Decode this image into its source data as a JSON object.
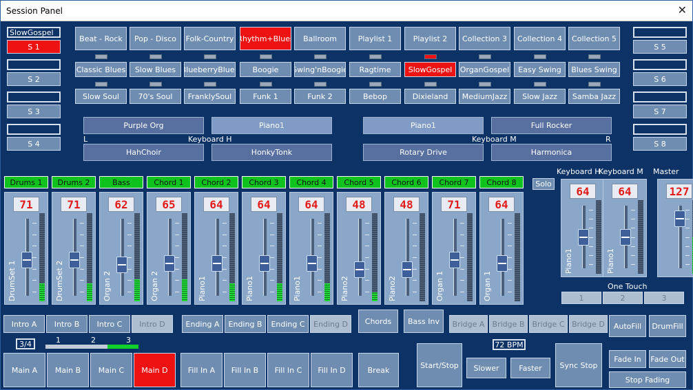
{
  "window": {
    "title": "Session Panel",
    "close_label": "✕"
  },
  "left_slots": [
    {
      "name": "SlowGospel",
      "button": "S 1",
      "active": true
    },
    {
      "name": "",
      "button": "S 2",
      "active": false
    },
    {
      "name": "",
      "button": "S 3",
      "active": false
    },
    {
      "name": "",
      "button": "S 4",
      "active": false
    }
  ],
  "right_slots": [
    {
      "name": "",
      "button": "S 5"
    },
    {
      "name": "",
      "button": "S 6"
    },
    {
      "name": "",
      "button": "S 7"
    },
    {
      "name": "",
      "button": "S 8"
    }
  ],
  "style_rows": [
    {
      "buttons": [
        "Beat - Rock",
        "Pop - Disco",
        "Folk-Country",
        "Rhythm+Blues",
        "Ballroom",
        "Playlist 1",
        "Playlist 2",
        "Collection 3",
        "Collection 4",
        "Collection 5"
      ],
      "active": 3
    },
    {
      "buttons": [
        "Classic Blues",
        "Slow Blues",
        "BlueberryBlues",
        "Boogie",
        "Swing'nBoogie",
        "Ragtime",
        "SlowGospel",
        "OrganGospel",
        "Easy Swing",
        "Blues Swing"
      ],
      "active": 6,
      "led_active": 6
    },
    {
      "buttons": [
        "Slow Soul",
        "70's Soul",
        "FranklySoul",
        "Funk 1",
        "Funk 2",
        "Bebop",
        "Dixieland",
        "MediumJazz",
        "Slow Jazz",
        "Samba Jazz"
      ],
      "active": -1
    }
  ],
  "keyboards": {
    "h_label": "Keyboard H",
    "m_label": "Keyboard M",
    "l_label": "L",
    "r_label": "R",
    "h_top": [
      "Purple Org",
      "Piano1"
    ],
    "h_bottom": [
      "HahChoir",
      "HonkyTonk"
    ],
    "m_top": [
      "Piano1",
      "Full Rocker"
    ],
    "m_bottom": [
      "Rotary Drive",
      "Harmonica"
    ]
  },
  "channels": [
    {
      "label": "Drums 1",
      "volume": "71",
      "instrument": "DrumSet 1",
      "level": 0.45,
      "meter": 0.2
    },
    {
      "label": "Drums 2",
      "volume": "71",
      "instrument": "DrumSet 2",
      "level": 0.45,
      "meter": 0.2
    },
    {
      "label": "Bass",
      "volume": "62",
      "instrument": "Organ 2",
      "level": 0.38,
      "meter": 0.25
    },
    {
      "label": "Chord 1",
      "volume": "65",
      "instrument": "Organ 2",
      "level": 0.4,
      "meter": 0.25
    },
    {
      "label": "Chord 2",
      "volume": "64",
      "instrument": "Piano1",
      "level": 0.4,
      "meter": 0.2
    },
    {
      "label": "Chord 3",
      "volume": "64",
      "instrument": "Piano1",
      "level": 0.4,
      "meter": 0.2
    },
    {
      "label": "Chord 4",
      "volume": "64",
      "instrument": "Piano1",
      "level": 0.4,
      "meter": 0.2
    },
    {
      "label": "Chord 5",
      "volume": "48",
      "instrument": "Piano2",
      "level": 0.3,
      "meter": 0.1
    },
    {
      "label": "Chord 6",
      "volume": "48",
      "instrument": "Piano2",
      "level": 0.3,
      "meter": 0
    },
    {
      "label": "Chord 7",
      "volume": "71",
      "instrument": "Organ 1",
      "level": 0.45,
      "meter": 0
    },
    {
      "label": "Chord 8",
      "volume": "64",
      "instrument": "Organ 1",
      "level": 0.4,
      "meter": 0
    }
  ],
  "solo_label": "Solo",
  "right_channels": [
    {
      "label": "Keyboard H",
      "volume": "64",
      "instrument": "Piano1",
      "level": 0.5
    },
    {
      "label": "Keyboard M",
      "volume": "64",
      "instrument": "Piano1",
      "level": 0.5
    },
    {
      "label": "Master",
      "volume": "127",
      "instrument": "",
      "level": 0.9
    }
  ],
  "one_touch": {
    "label": "One Touch",
    "buttons": [
      "1",
      "2",
      "3"
    ]
  },
  "intros": [
    "Intro A",
    "Intro B",
    "Intro C",
    "Intro D"
  ],
  "endings": [
    "Ending A",
    "Ending B",
    "Ending C",
    "Ending D"
  ],
  "chords_label": "Chords",
  "bassinv_label": "Bass Inv",
  "bridges": [
    "Bridge A",
    "Bridge B",
    "Bridge C",
    "Bridge D"
  ],
  "autofill_label": "AutoFill",
  "drumfill_label": "DrumFill",
  "time_signature": "3/4",
  "beat_labels": [
    "1",
    "2",
    "3"
  ],
  "current_beat": 3,
  "bpm": "72 BPM",
  "mains": [
    "Main A",
    "Main B",
    "Main C",
    "Main D"
  ],
  "active_main": 3,
  "fills": [
    "Fill In A",
    "Fill In B",
    "Fill In C",
    "Fill In D"
  ],
  "break_label": "Break",
  "startstop_label": "Start/Stop",
  "slower_label": "Slower",
  "faster_label": "Faster",
  "syncstop_label": "Sync Stop",
  "fadein_label": "Fade In",
  "fadeout_label": "Fade Out",
  "stopfading_label": "Stop Fading"
}
